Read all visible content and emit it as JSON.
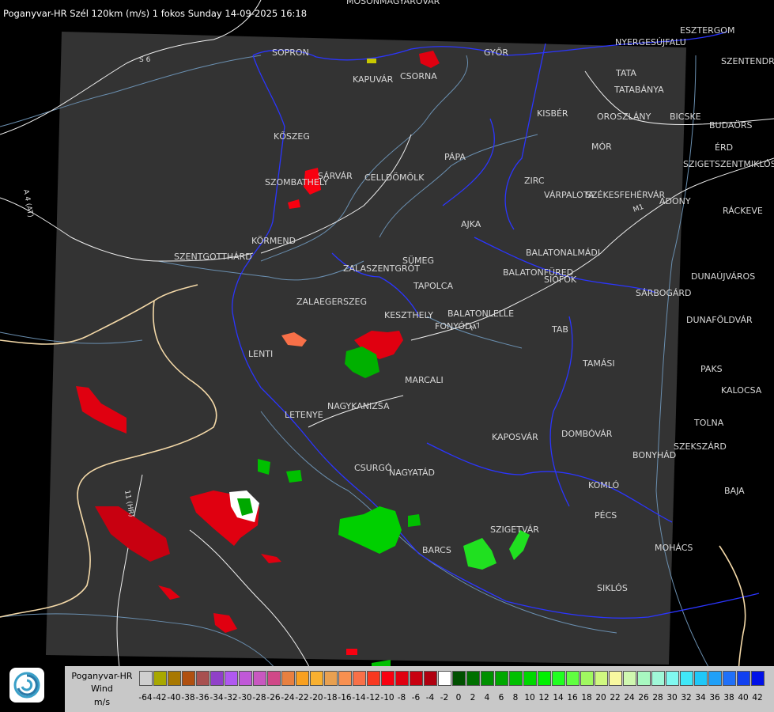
{
  "title": "Poganyvar-HR Szél 120km (m/s) 1 fokos Sunday 14-09-2025 16:18",
  "colors": {
    "background": "#000000",
    "radar_area": "#333333",
    "border_blue": "#2b35ff",
    "river": "#6a8fb0",
    "road": "#f0f0f0",
    "country_border": "#f4d9a8"
  },
  "logo_icon": "radar-swirl-icon",
  "cities": [
    "MOSONMAGYARÓVÁR",
    "SOPRON",
    "KAPUVÁR",
    "CSORNA",
    "GYŐR",
    "ESZTERGOM",
    "NYERGESÚJFALU",
    "SZENTENDRE",
    "TATA",
    "TATABÁNYA",
    "KISBÉR",
    "OROSZLÁNY",
    "BICSKE",
    "BUDAÖRS",
    "MÓR",
    "ÉRD",
    "SZIGETSZENTMIKLÓS",
    "KŐSZEG",
    "PÁPA",
    "SÁRVÁR",
    "CELLDÖMÖLK",
    "SZOMBATHELY",
    "ZIRC",
    "VÁRPALOTA",
    "SZÉKESFEHÉRVÁR",
    "ADONY",
    "RÁCKEVE",
    "AJKA",
    "KÖRMEND",
    "SZENTGOTTHÁRD",
    "BALATONALMÁDI",
    "SÜMEG",
    "ZALASZENTGRÓT",
    "BALATONFÜRED",
    "SIÓFOK",
    "DUNAÚJVÁROS",
    "TAPOLCA",
    "SÁRBOGÁRD",
    "ZALAEGERSZEG",
    "KESZTHELY",
    "BALATONLELLE",
    "FONYÓD",
    "DUNAFÖLDVÁR",
    "TAB",
    "LENTI",
    "TAMÁSI",
    "PAKS",
    "MARCALI",
    "KALOCSA",
    "LETENYE",
    "NAGYKANIZSA",
    "TOLNA",
    "KAPOSVÁR",
    "DOMBÓVÁR",
    "SZEKSZÁRD",
    "BONYHÁD",
    "CSURGÓ",
    "NAGYATÁD",
    "KOMLÓ",
    "BAJA",
    "PÉCS",
    "SZIGETVÁR",
    "MOHÁCS",
    "BARCS",
    "SIKLÓS"
  ],
  "roads": [
    "S 6",
    "A 4 (AT)",
    "11 (HR)",
    "M7",
    "M1"
  ],
  "legend": {
    "radar_name": "Poganyvar-HR",
    "quantity": "Wind",
    "unit": "m/s",
    "ticks": [
      "-64",
      "-42",
      "-40",
      "-38",
      "-36",
      "-34",
      "-32",
      "-30",
      "-28",
      "-26",
      "-24",
      "-22",
      "-20",
      "-18",
      "-16",
      "-14",
      "-12",
      "-10",
      "-8",
      "-6",
      "-4",
      "-2",
      "0",
      "2",
      "4",
      "6",
      "8",
      "10",
      "12",
      "14",
      "16",
      "18",
      "20",
      "22",
      "24",
      "26",
      "28",
      "30",
      "32",
      "34",
      "36",
      "38",
      "40",
      "42"
    ],
    "colors": [
      "#cfcfcf",
      "#a8a800",
      "#a87800",
      "#b05010",
      "#a85050",
      "#9040c8",
      "#b058f0",
      "#c058d8",
      "#c858c0",
      "#d04888",
      "#e88040",
      "#f8a020",
      "#f8b030",
      "#e8a050",
      "#f89050",
      "#f87048",
      "#f83820",
      "#f80010",
      "#e00010",
      "#c80010",
      "#b00010",
      "#ffffff",
      "#005000",
      "#007000",
      "#009000",
      "#00a800",
      "#00c000",
      "#00d800",
      "#00f000",
      "#20ff20",
      "#60ff40",
      "#a0f860",
      "#d0f880",
      "#f8f8a0",
      "#d0f8b0",
      "#a8f8c0",
      "#a0f8d8",
      "#80f8f0",
      "#40e8f8",
      "#20c8f8",
      "#20a0f8",
      "#2070f8",
      "#1040f0",
      "#0010e8"
    ]
  }
}
